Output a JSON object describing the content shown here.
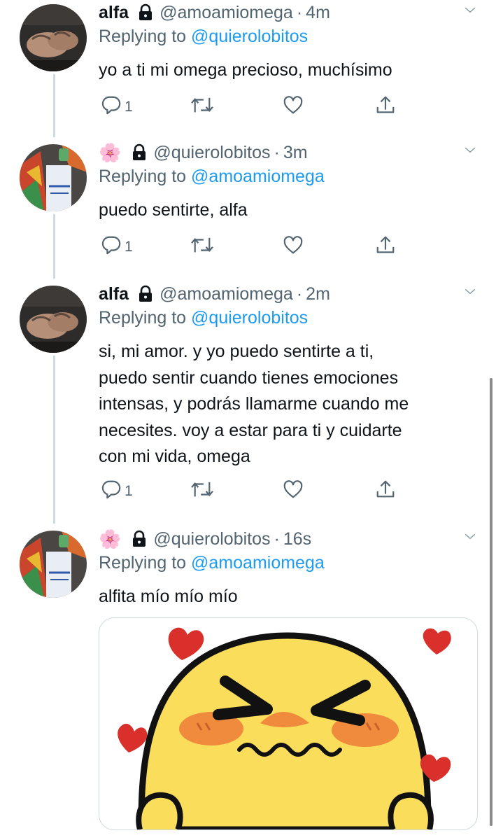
{
  "colors": {
    "text": "#0f1419",
    "secondary": "#536471",
    "link": "#1d9bf0",
    "thread_line": "#cfd9de",
    "heart_red": "#d9302c",
    "duck_yellow": "#fbdd5c"
  },
  "tweets": [
    {
      "display_name": "alfa",
      "handle": "@amoamiomega",
      "time": "4m",
      "replying_prefix": "Replying to ",
      "replying_to": "@quierolobitos",
      "text": "yo a ti mi omega precioso, muchísimo",
      "reply_count": "1"
    },
    {
      "display_name": "🌸",
      "handle": "@quierolobitos",
      "time": "3m",
      "replying_prefix": "Replying to ",
      "replying_to": "@amoamiomega",
      "text": "puedo sentirte, alfa",
      "reply_count": "1"
    },
    {
      "display_name": "alfa",
      "handle": "@amoamiomega",
      "time": "2m",
      "replying_prefix": "Replying to ",
      "replying_to": "@quierolobitos",
      "text": "si, mi amor. y yo puedo sentirte a ti,\npuedo sentir cuando tienes emociones\nintensas, y podrás llamarme cuando me\nnecesites. voy a estar para ti y cuidarte\ncon mi vida, omega",
      "reply_count": "1"
    },
    {
      "display_name": "🌸",
      "handle": "@quierolobitos",
      "time": "16s",
      "replying_prefix": "Replying to ",
      "replying_to": "@amoamiomega",
      "text": "alfita mío mío mío"
    }
  ],
  "icons": {
    "lock": "lock-icon",
    "chevron": "chevron-down-icon",
    "reply": "reply-icon",
    "retweet": "retweet-icon",
    "like": "heart-icon",
    "share": "share-icon"
  }
}
